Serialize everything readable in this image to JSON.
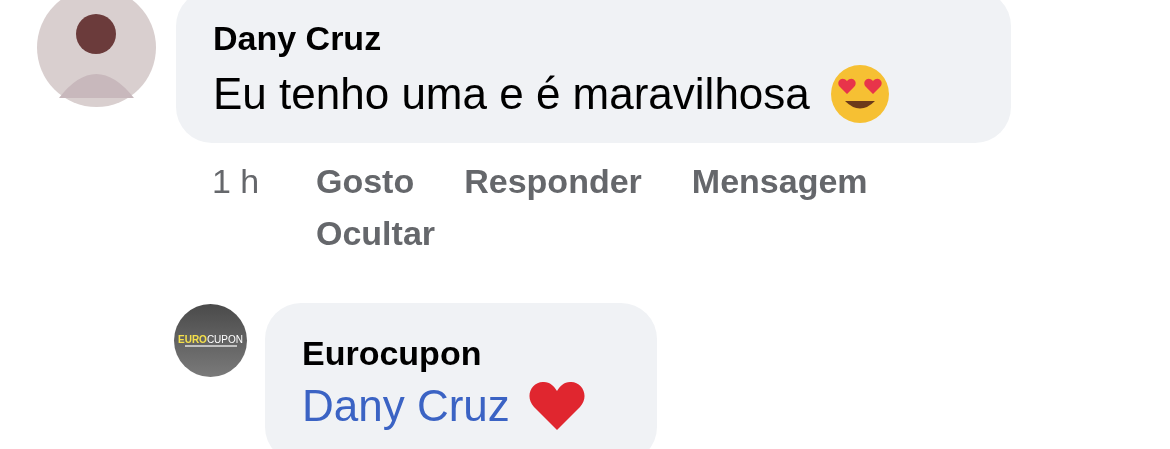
{
  "comment": {
    "author": "Dany Cruz",
    "text": "Eu tenho uma e é maravilhosa",
    "time": "1 h",
    "actions": [
      {
        "label": "Gosto"
      },
      {
        "label": "Responder"
      },
      {
        "label": "Mensagem"
      },
      {
        "label": "Ocultar"
      }
    ]
  },
  "reply": {
    "author": "Eurocupon",
    "avatar": {
      "logo_parts": [
        "EURO",
        "CUPON"
      ]
    },
    "mention": "Dany Cruz"
  }
}
